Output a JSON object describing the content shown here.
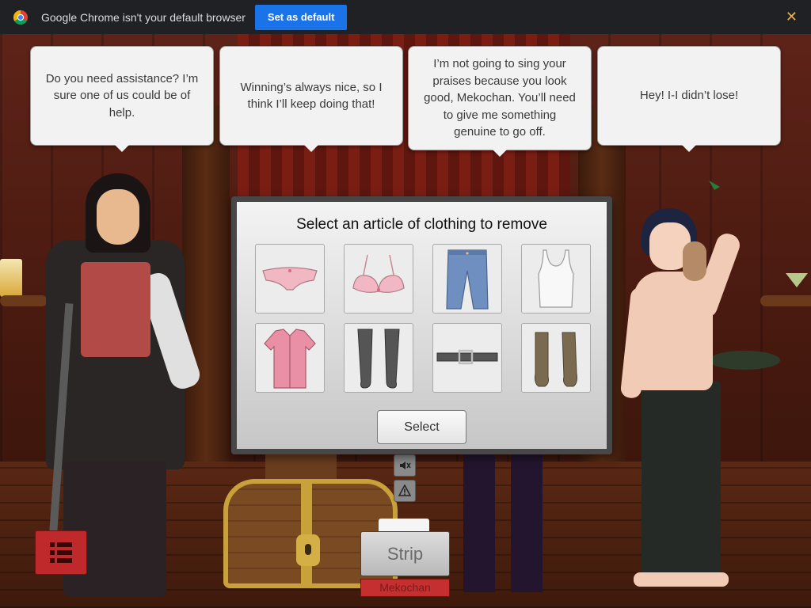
{
  "infobar": {
    "message": "Google Chrome isn't your default browser",
    "button_label": "Set as default",
    "close_glyph": "✕"
  },
  "bubbles": [
    {
      "text": "Do you need assistance? I’m sure one of us could be of help."
    },
    {
      "text": "Winning’s always nice, so I think I’ll keep doing that!"
    },
    {
      "text": "I’m not going to sing your praises because you look good, Mekochan. You’ll need to give me something genuine to go off."
    },
    {
      "text": "Hey! I-I didn’t lose!"
    }
  ],
  "modal": {
    "title": "Select an article of clothing to remove",
    "items": [
      {
        "name": "panties",
        "icon": "panties-icon",
        "color": "#f1b8c4"
      },
      {
        "name": "bra",
        "icon": "bra-icon",
        "color": "#f1b8c4"
      },
      {
        "name": "jeans",
        "icon": "jeans-icon",
        "color": "#6f8fc0"
      },
      {
        "name": "tank-top",
        "icon": "tank-top-icon",
        "color": "#f8f8f8"
      },
      {
        "name": "shirt",
        "icon": "shirt-icon",
        "color": "#e98fa6"
      },
      {
        "name": "stockings",
        "icon": "stockings-icon",
        "color": "#555555"
      },
      {
        "name": "belt",
        "icon": "belt-icon",
        "color": "#555555"
      },
      {
        "name": "boots",
        "icon": "boots-icon",
        "color": "#7a6a50"
      }
    ],
    "select_label": "Select"
  },
  "controls": {
    "strip_label": "Strip",
    "player_name": "Mekochan",
    "mute_icon": "speaker-mute-icon",
    "report_icon": "warning-icon",
    "menu_icon": "list-menu-icon"
  }
}
